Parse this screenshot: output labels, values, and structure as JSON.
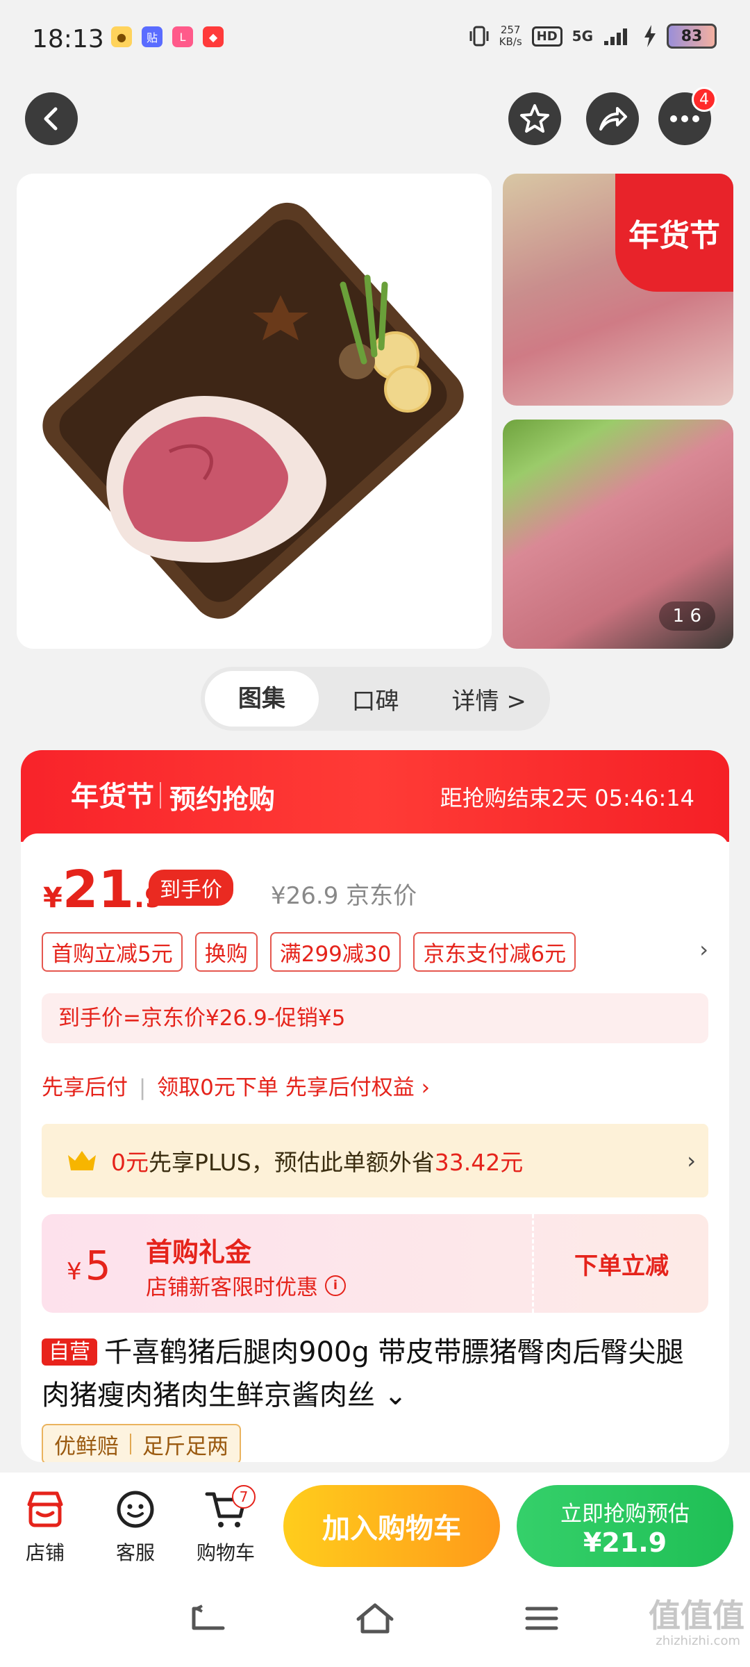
{
  "status": {
    "time": "18:13",
    "speed_value": "257",
    "speed_unit": "KB/s",
    "hd": "HD",
    "network": "5G",
    "battery": "83",
    "apps": [
      "ant-icon",
      "tieba-icon",
      "lofter-icon",
      "red-app-icon"
    ]
  },
  "header": {
    "more_badge": "4"
  },
  "gallery": {
    "festival_tag": "年货节",
    "counter": "1  6"
  },
  "tabs": [
    {
      "label": "图集"
    },
    {
      "label": "口碑"
    },
    {
      "label": "详情 >"
    }
  ],
  "promo": {
    "festival": "年货节",
    "title": "预约抢购",
    "countdown": "距抢购结束2天  05:46:14"
  },
  "price": {
    "currency": "¥",
    "integer": "21",
    "decimal": ".9",
    "arrival_tag": "到手价",
    "jd_price": "¥26.9 京东价"
  },
  "coupons": [
    "首购立减5元",
    "换购",
    "满299减30",
    "京东支付减6元"
  ],
  "calc_text": "到手价=京东价¥26.9-促销¥5",
  "pay_later": {
    "part1": "先享后付",
    "sep": "|",
    "part2": "领取0元下单 先享后付权益 ›"
  },
  "plus": {
    "hl1": "0元",
    "text1": "先享PLUS，预估此单额外省",
    "hl2": "33.42元",
    "arrow": "›"
  },
  "gift": {
    "currency": "¥",
    "amount": "5",
    "title": "首购礼金",
    "subtitle": "店铺新客限时优惠",
    "info": "i",
    "action": "下单立减"
  },
  "product": {
    "self_tag": "自营",
    "title": "千喜鹤猪后腿肉900g 带皮带膘猪臀肉后臀尖腿肉猪瘦肉猪肉生鲜京酱肉丝 ⌄"
  },
  "guarantees": [
    "优鲜赔",
    "足斤足两"
  ],
  "bottom": {
    "shop": "店铺",
    "service": "客服",
    "cart": "购物车",
    "cart_badge": "7",
    "add_cart": "加入购物车",
    "buy_line1": "立即抢购预估",
    "buy_line2": "¥21.9"
  },
  "watermark": {
    "main": "值值值",
    "sub": "zhizhizhi.com"
  },
  "colors": {
    "accent_red": "#e5231b",
    "promo_red": "#f8232a",
    "cart_orange": "#ff9a1a",
    "buy_green": "#1fbf55"
  }
}
